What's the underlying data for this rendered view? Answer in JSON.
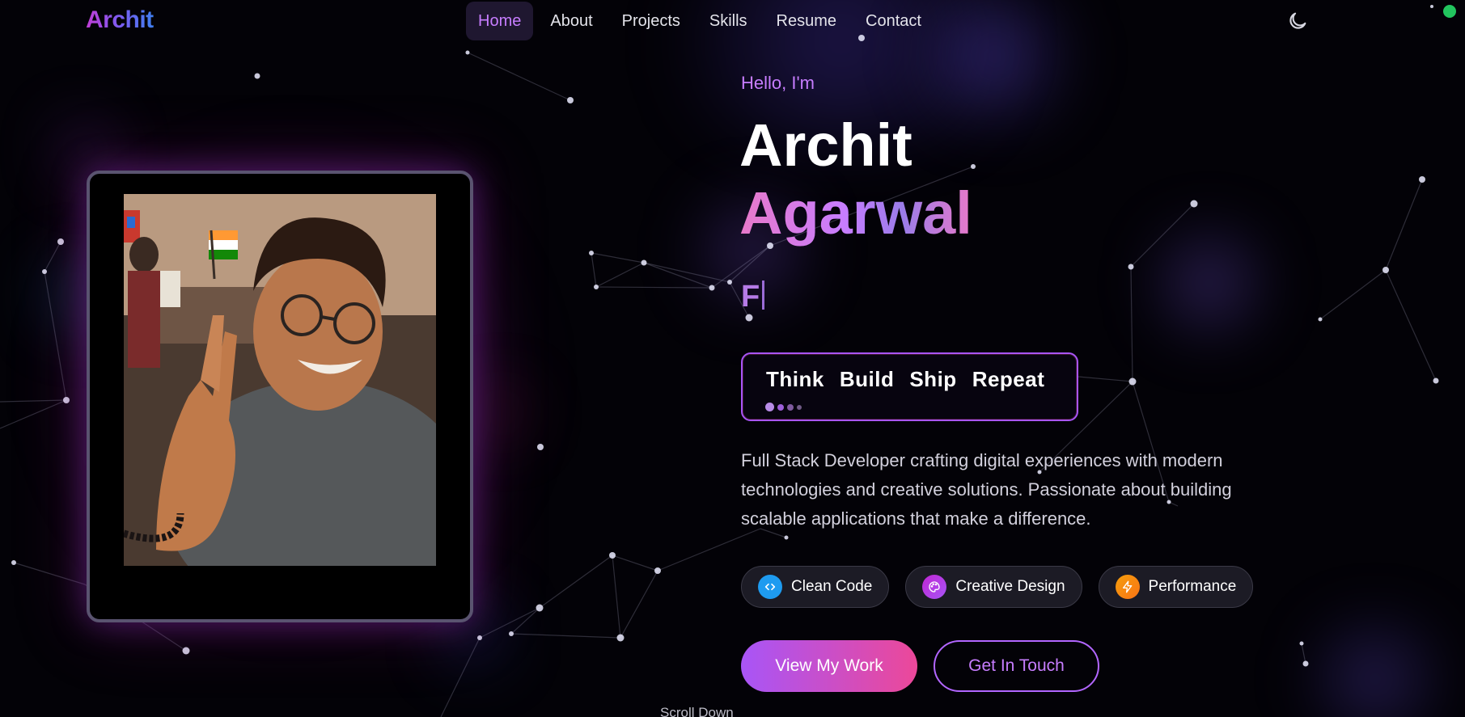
{
  "brand": {
    "logo_text": "Archit"
  },
  "nav": {
    "items": [
      {
        "label": "Home",
        "active": true
      },
      {
        "label": "About"
      },
      {
        "label": "Projects"
      },
      {
        "label": "Skills"
      },
      {
        "label": "Resume"
      },
      {
        "label": "Contact"
      }
    ],
    "theme_toggle_icon": "moon-icon",
    "status_color": "#22c55e"
  },
  "hero": {
    "greeting": "Hello, I'm",
    "first_name": "Archit",
    "last_name": "Agarwal",
    "typed_text": "F",
    "motto": [
      "Think",
      "Build",
      "Ship",
      "Repeat"
    ],
    "description": "Full Stack Developer crafting digital experiences with modern technologies and creative solutions. Passionate about building scalable applications that make a difference.",
    "chips": [
      {
        "label": "Clean Code",
        "icon": "code-icon",
        "color": "#1e9bf0"
      },
      {
        "label": "Creative Design",
        "icon": "palette-icon",
        "color": "#c026d3"
      },
      {
        "label": "Performance",
        "icon": "lightning-icon",
        "color": "#f59e0b"
      }
    ],
    "primary_button": "View My Work",
    "secondary_button": "Get In Touch",
    "scroll_hint": "Scroll Down"
  },
  "colors": {
    "accent_purple": "#a855f7",
    "accent_pink": "#ec4899",
    "background": "#030207"
  }
}
